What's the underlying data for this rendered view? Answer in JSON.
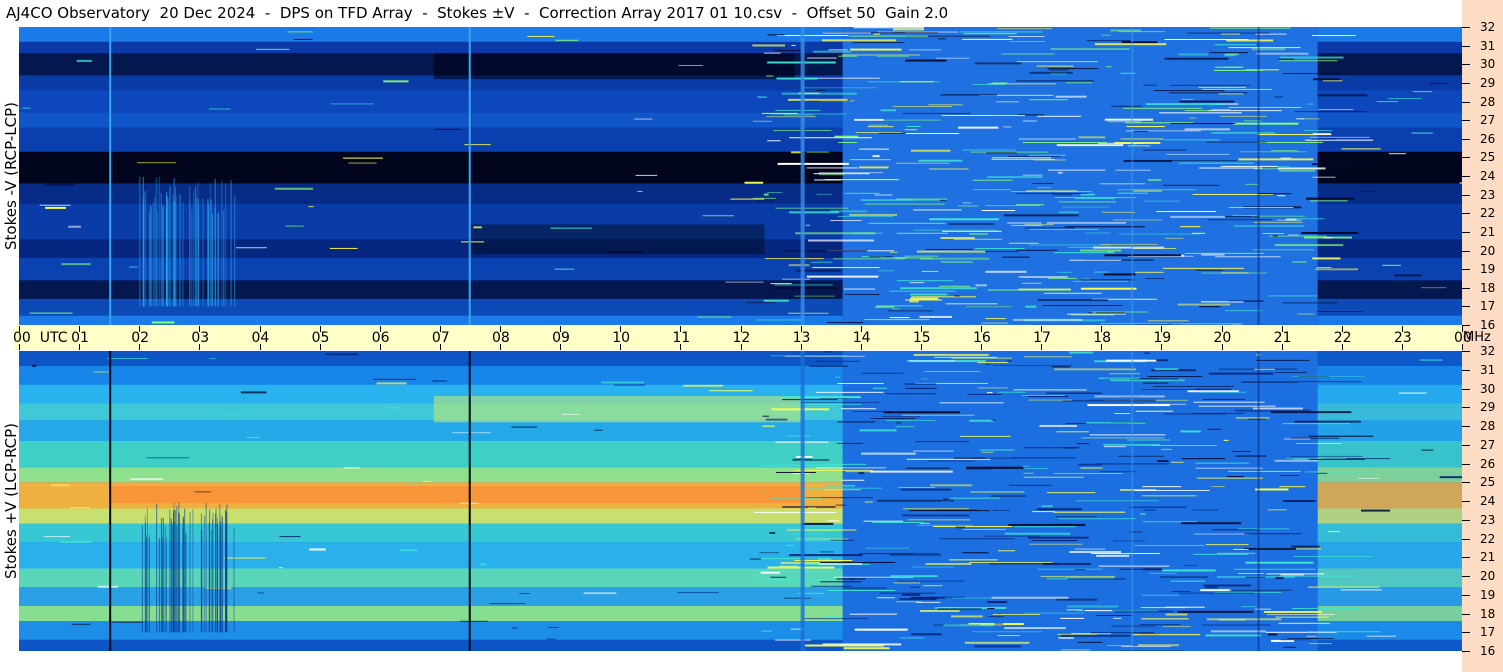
{
  "header": {
    "title": "AJ4CO Observatory  20 Dec 2024  -  DPS on TFD Array  -  Stokes ±V  -  Correction Array 2017 01 10.csv  -  Offset 50  Gain 2.0"
  },
  "panels": {
    "top_label": "Stokes -V (RCP-LCP)",
    "bottom_label": "Stokes +V (LCP-RCP)"
  },
  "time_axis": {
    "labels": [
      "00  UTC",
      "01",
      "02",
      "03",
      "04",
      "05",
      "06",
      "07",
      "08",
      "09",
      "10",
      "11",
      "12",
      "13",
      "14",
      "15",
      "16",
      "17",
      "18",
      "19",
      "20",
      "21",
      "22",
      "23",
      "00"
    ],
    "unit": "MHz"
  },
  "chart_data": [
    {
      "type": "heatmap",
      "series_label": "Stokes -V (RCP-LCP)",
      "x_labels": [
        "00 UTC",
        "01",
        "02",
        "03",
        "04",
        "05",
        "06",
        "07",
        "08",
        "09",
        "10",
        "11",
        "12",
        "13",
        "14",
        "15",
        "16",
        "17",
        "18",
        "19",
        "20",
        "21",
        "22",
        "23",
        "00"
      ],
      "y_ticks": [
        32,
        31,
        30,
        29,
        28,
        27,
        26,
        25,
        24,
        23,
        22,
        21,
        20,
        19,
        18,
        17,
        16
      ],
      "ylim": [
        16,
        32
      ],
      "x_range_hours": [
        0,
        24
      ],
      "colors": {
        "low": "#000022",
        "mid": "#1d6de0",
        "high": "#ffff40"
      }
    },
    {
      "type": "heatmap",
      "series_label": "Stokes +V (LCP-RCP)",
      "x_labels": [
        "00 UTC",
        "01",
        "02",
        "03",
        "04",
        "05",
        "06",
        "07",
        "08",
        "09",
        "10",
        "11",
        "12",
        "13",
        "14",
        "15",
        "16",
        "17",
        "18",
        "19",
        "20",
        "21",
        "22",
        "23",
        "00"
      ],
      "y_ticks": [
        32,
        31,
        30,
        29,
        28,
        27,
        26,
        25,
        24,
        23,
        22,
        21,
        20,
        19,
        18,
        17,
        16
      ],
      "ylim": [
        16,
        32
      ],
      "x_range_hours": [
        0,
        24
      ],
      "colors": {
        "low": "#000022",
        "mid": "#1d6de0",
        "high": "#ff8a3a"
      }
    }
  ]
}
